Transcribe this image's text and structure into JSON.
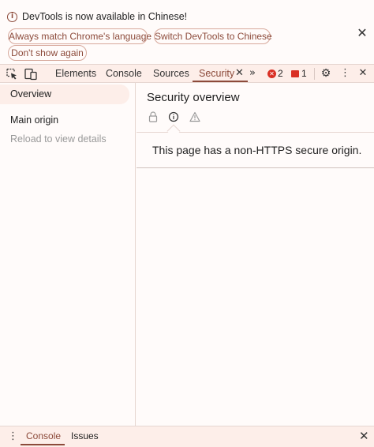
{
  "infobar": {
    "message": "DevTools is now available in Chinese!",
    "match_language_label": "Always match Chrome's language",
    "switch_language_label": "Switch DevTools to Chinese",
    "dont_show_label": "Don't show again",
    "info_glyph": "i",
    "close_glyph": "✕"
  },
  "toolbar": {
    "tabs": [
      {
        "label": "Elements"
      },
      {
        "label": "Console"
      },
      {
        "label": "Sources"
      },
      {
        "label": "Security"
      }
    ],
    "active_tab": "Security",
    "error_count": "2",
    "issue_count": "1",
    "more_tabs_glyph": "»",
    "close_glyph": "✕",
    "settings_glyph": "⚙",
    "menu_glyph": "⋮",
    "error_glyph": "✕",
    "icons": [
      "inspect-element-icon",
      "device-toggle-icon",
      "chevrons-right-icon",
      "error-icon",
      "issue-flag-icon",
      "gear-icon",
      "kebab-menu-icon",
      "close-icon"
    ]
  },
  "sidebar": {
    "items": [
      {
        "label": "Overview",
        "selected": true
      },
      {
        "label": "Main origin",
        "selected": false
      },
      {
        "label": "Reload to view details",
        "selected": false
      }
    ]
  },
  "main": {
    "title": "Security overview",
    "filters": [
      "lock-icon",
      "info-icon",
      "warning-icon"
    ],
    "message": "This page has a non-HTTPS secure origin."
  },
  "drawer": {
    "tabs": [
      {
        "label": "Console"
      },
      {
        "label": "Issues"
      }
    ],
    "active_tab": "Console",
    "menu_glyph": "⋮",
    "close_glyph": "✕"
  },
  "colors": {
    "accent": "#8c4a3a",
    "error": "#d93025",
    "toolbar_bg": "#fdeee9",
    "page_bg": "#fffbfa"
  }
}
